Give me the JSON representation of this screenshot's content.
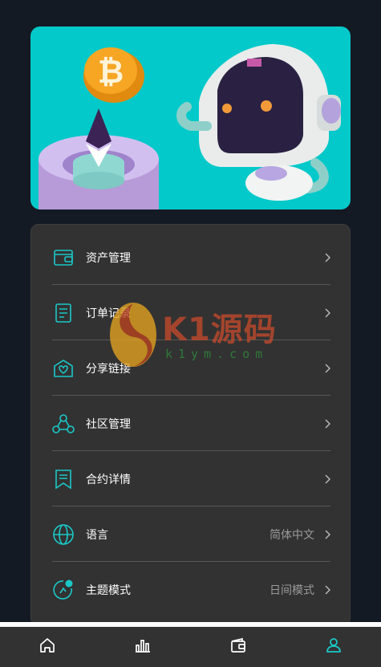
{
  "menu": {
    "items": [
      {
        "label": "资产管理",
        "value": "",
        "icon": "wallet-icon"
      },
      {
        "label": "订单记录",
        "value": "",
        "icon": "document-list-icon"
      },
      {
        "label": "分享链接",
        "value": "",
        "icon": "share-heart-icon"
      },
      {
        "label": "社区管理",
        "value": "",
        "icon": "community-icon"
      },
      {
        "label": "合约详情",
        "value": "",
        "icon": "contract-bookmark-icon"
      },
      {
        "label": "语言",
        "value": "简体中文",
        "icon": "globe-icon"
      },
      {
        "label": "主题模式",
        "value": "日间模式",
        "icon": "theme-icon"
      }
    ]
  },
  "watermark": {
    "title": "K1源码",
    "domain": "k1ym.com"
  },
  "tabbar": {
    "tabs": [
      {
        "icon": "home-icon",
        "active": false
      },
      {
        "icon": "market-chart-icon",
        "active": false
      },
      {
        "icon": "wallet-icon",
        "active": false
      },
      {
        "icon": "user-icon",
        "active": true
      }
    ]
  },
  "colors": {
    "background": "#141a24",
    "card": "#323232",
    "accent": "#1bc8c8",
    "divider": "#575757",
    "banner_bg": "#00c8c8"
  }
}
